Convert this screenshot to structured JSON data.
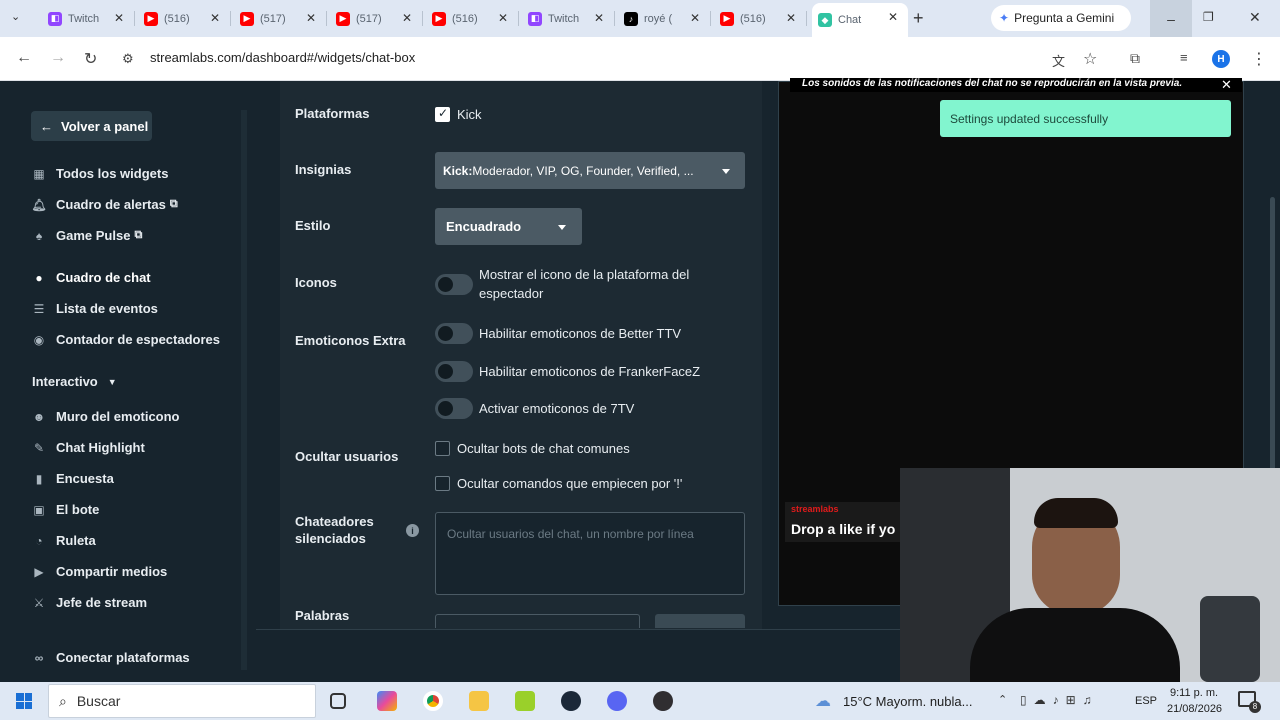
{
  "tabs": [
    {
      "label": "Twitch",
      "icon": "twitch-icon",
      "color": "#9146ff"
    },
    {
      "label": "(516)",
      "icon": "youtube-icon",
      "color": "#ff0000"
    },
    {
      "label": "(517)",
      "icon": "youtube-icon",
      "color": "#ff0000"
    },
    {
      "label": "(517)",
      "icon": "youtube-icon",
      "color": "#ff0000"
    },
    {
      "label": "(516)",
      "icon": "youtube-icon",
      "color": "#ff0000"
    },
    {
      "label": "Twitch",
      "icon": "twitch-icon",
      "color": "#9146ff"
    },
    {
      "label": "royé (",
      "icon": "tiktok-icon",
      "color": "#000000"
    },
    {
      "label": "(516)",
      "icon": "youtube-icon",
      "color": "#ff0000"
    },
    {
      "label": "Chat",
      "icon": "streamlabs-icon",
      "color": "#31c3a2"
    }
  ],
  "gemini_label": "Pregunta a Gemini",
  "url": "streamlabs.com/dashboard#/widgets/chat-box",
  "profile_initial": "H",
  "sidebar": {
    "back_label": "Volver a panel",
    "items": [
      {
        "label": "Todos los widgets",
        "icon": "grid-icon"
      },
      {
        "label": "Cuadro de alertas",
        "icon": "bell-icon"
      },
      {
        "label": "Game Pulse",
        "icon": "pulse-icon"
      },
      {
        "label": "Cuadro de chat",
        "icon": "chat-icon"
      },
      {
        "label": "Lista de eventos",
        "icon": "list-icon"
      },
      {
        "label": "Contador de espectadores",
        "icon": "eye-icon"
      }
    ],
    "section_label": "Interactivo",
    "interactive": [
      {
        "label": "Muro del emoticono",
        "icon": "emoji-icon"
      },
      {
        "label": "Chat Highlight",
        "icon": "pencil-icon"
      },
      {
        "label": "Encuesta",
        "icon": "poll-icon"
      },
      {
        "label": "El bote",
        "icon": "jar-icon"
      },
      {
        "label": "Ruleta",
        "icon": "wheel-icon"
      },
      {
        "label": "Compartir medios",
        "icon": "media-icon"
      },
      {
        "label": "Jefe de stream",
        "icon": "sword-icon"
      }
    ],
    "connect_label": "Conectar plataformas"
  },
  "settings": {
    "platforms_label": "Plataformas",
    "platform_kick": "Kick",
    "badges_label": "Insignias",
    "badges_value_bold": "Kick:",
    "badges_value": " Moderador, VIP, OG, Founder, Verified, ...",
    "style_label": "Estilo",
    "style_value": "Encuadrado",
    "icons_label": "Iconos",
    "icons_option_line1": "Mostrar el icono de la plataforma del",
    "icons_option_line2": "espectador",
    "emotes_label": "Emoticonos Extra",
    "emote_bttv": "Habilitar emoticonos de Better TTV",
    "emote_ffz": "Habilitar emoticonos de FrankerFaceZ",
    "emote_7tv": "Activar emoticonos de 7TV",
    "hide_users_label": "Ocultar usuarios",
    "hide_bots": "Ocultar bots de chat comunes",
    "hide_commands": "Ocultar comandos que empiecen por '!'",
    "muted_label_line1": "Chateadores",
    "muted_label_line2": "silenciados",
    "muted_placeholder": "Ocultar usuarios del chat, un nombre por línea",
    "words_label": "Palabras"
  },
  "preview": {
    "notice": "Los sonidos de las notificaciones del chat no se reproducirán en la vista previa.",
    "toast": "Settings updated successfully",
    "chat_user": "streamlabs",
    "chat_message": "Drop a like if yo"
  },
  "taskbar": {
    "search_placeholder": "Buscar",
    "weather": "15°C  Mayorm. nubla...",
    "lang": "ESP",
    "time": "9:11 p. m.",
    "date": "21/08/2026",
    "notif_count": "8"
  }
}
